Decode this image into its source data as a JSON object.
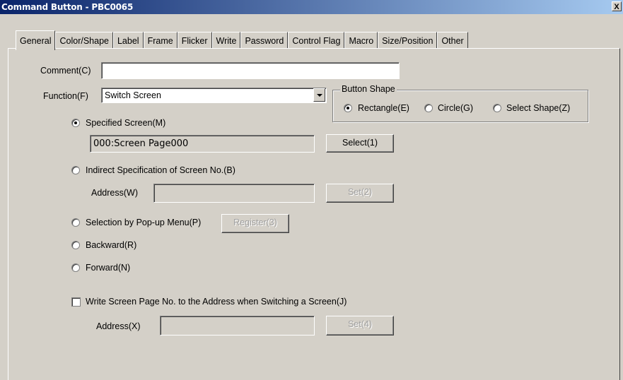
{
  "window": {
    "title": "Command Button - PBC0065",
    "close_label": "X"
  },
  "tabs": [
    {
      "label": "General",
      "active": true
    },
    {
      "label": "Color/Shape"
    },
    {
      "label": "Label"
    },
    {
      "label": "Frame"
    },
    {
      "label": "Flicker"
    },
    {
      "label": "Write"
    },
    {
      "label": "Password"
    },
    {
      "label": "Control Flag"
    },
    {
      "label": "Macro"
    },
    {
      "label": "Size/Position"
    },
    {
      "label": "Other"
    }
  ],
  "comment": {
    "label": "Comment(C)",
    "value": ""
  },
  "function": {
    "label": "Function(F)",
    "selected": "Switch Screen"
  },
  "button_shape": {
    "title": "Button Shape",
    "options": [
      {
        "label": "Rectangle(E)",
        "checked": true
      },
      {
        "label": "Circle(G)",
        "checked": false
      },
      {
        "label": "Select Shape(Z)",
        "checked": false
      }
    ]
  },
  "specified_screen": {
    "label": "Specified Screen(M)",
    "checked": true,
    "value": "000:Screen Page000",
    "button": "Select(1)"
  },
  "indirect": {
    "label": "Indirect Specification of Screen No.(B)",
    "checked": false,
    "address_label": "Address(W)",
    "address_value": "",
    "button": "Set(2)"
  },
  "popup": {
    "label": "Selection by Pop-up Menu(P)",
    "checked": false,
    "button": "Register(3)"
  },
  "backward": {
    "label": "Backward(R)",
    "checked": false
  },
  "forward": {
    "label": "Forward(N)",
    "checked": false
  },
  "write_page": {
    "label": "Write Screen Page No. to the Address when Switching a Screen(J)",
    "checked": false,
    "address_label": "Address(X)",
    "address_value": "",
    "button": "Set(4)"
  }
}
